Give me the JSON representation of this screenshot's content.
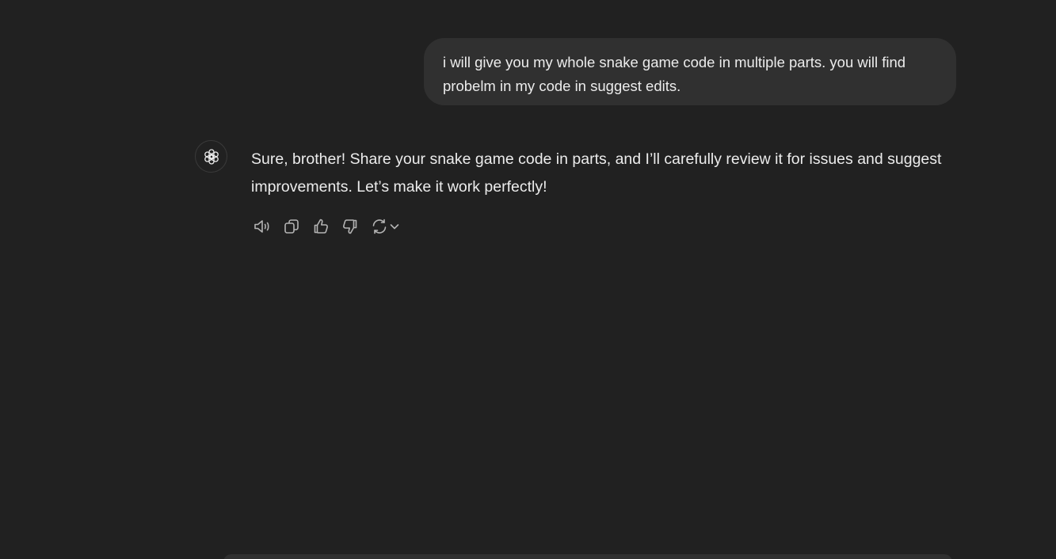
{
  "conversation": {
    "user_message": "i will give you my whole snake game code in multiple parts. you will find probelm in my code in suggest edits.",
    "assistant_message": "Sure, brother! Share your snake game code in parts, and I’ll carefully review it for issues and suggest improvements. Let’s make it work perfectly!",
    "assistant_avatar_icon": "openai-logo-icon"
  },
  "message_actions": [
    {
      "icon": "speaker-icon"
    },
    {
      "icon": "copy-icon"
    },
    {
      "icon": "thumbs-up-icon"
    },
    {
      "icon": "thumbs-down-icon"
    },
    {
      "icon": "regenerate-icon"
    }
  ],
  "colors": {
    "background": "#212121",
    "user_bubble": "#303030",
    "text": "#ececec",
    "icon": "#b4b4b4"
  }
}
